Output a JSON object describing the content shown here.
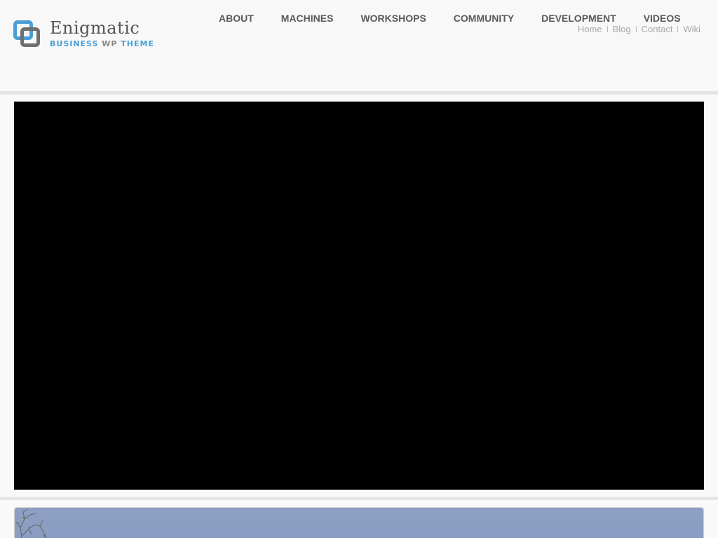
{
  "brand": {
    "title": "Enigmatic",
    "tagline_part1": "BUSINESS",
    "tagline_part2": "WP",
    "tagline_part3": "THEME"
  },
  "main_nav": [
    {
      "label": "ABOUT"
    },
    {
      "label": "MACHINES"
    },
    {
      "label": "WORKSHOPS"
    },
    {
      "label": "COMMUNITY"
    },
    {
      "label": "DEVELOPMENT"
    },
    {
      "label": "VIDEOS"
    }
  ],
  "secondary_nav": [
    {
      "label": "Home"
    },
    {
      "label": "Blog"
    },
    {
      "label": "Contact"
    },
    {
      "label": "Wiki"
    }
  ],
  "colors": {
    "accent": "#4a9fd4",
    "logo_gray": "#6f6f6f",
    "nav_text": "#5a5a5a",
    "secondary_text": "#a8a8a8",
    "video_bg": "#000000",
    "sky": "#8a9ec2"
  }
}
